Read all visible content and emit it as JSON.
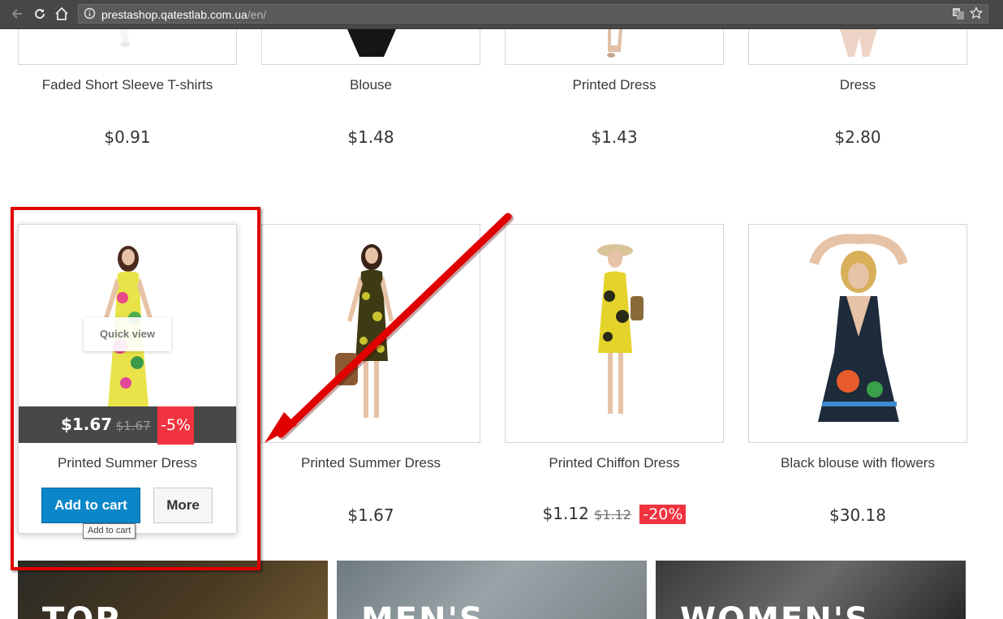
{
  "browser": {
    "url_host": "prestashop.qatestlab.com.ua",
    "url_path": "/en/"
  },
  "row1": [
    {
      "name": "Faded Short Sleeve T-shirts",
      "price": "$0.91"
    },
    {
      "name": "Blouse",
      "price": "$1.48"
    },
    {
      "name": "Printed Dress",
      "price": "$1.43"
    },
    {
      "name": "Dress",
      "price": "$2.80"
    }
  ],
  "row2": [
    {
      "name": "Printed Summer Dress",
      "price": "$1.67",
      "old_price": "$1.67",
      "discount": "-5%",
      "quick_view": "Quick view",
      "add_to_cart": "Add to cart",
      "more": "More",
      "tooltip": "Add to cart"
    },
    {
      "name": "Printed Summer Dress",
      "price": "$1.67"
    },
    {
      "name": "Printed Chiffon Dress",
      "price": "$1.12",
      "old_price": "$1.12",
      "discount": "-20%"
    },
    {
      "name": "Black blouse with flowers",
      "price": "$30.18"
    }
  ],
  "banners": [
    "TOP",
    "MEN'S",
    "WOMEN'S"
  ],
  "colors": {
    "accent_red": "#f13340",
    "cart_blue": "#0b86c9",
    "annotation_red": "#e00000"
  }
}
